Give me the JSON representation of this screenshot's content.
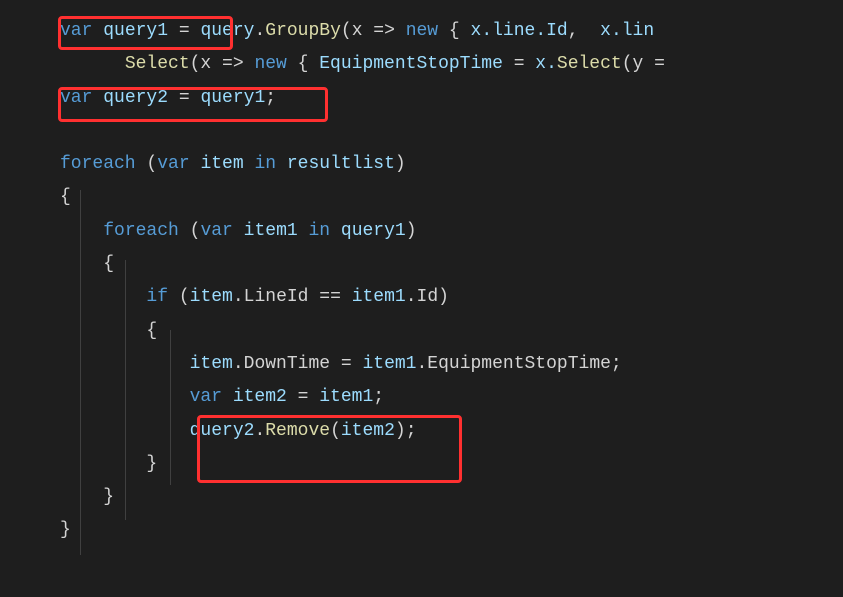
{
  "code": {
    "line1": {
      "var": "var",
      "query1": "query1",
      "eq": " = ",
      "query": "query",
      "dot": ".",
      "groupby": "GroupBy",
      "open": "(x => ",
      "new": "new",
      "brace": " { ",
      "xline": "x.line.Id",
      "comma": ",  ",
      "xlin": "x.lin"
    },
    "line2": {
      "select": "Select",
      "open": "(x => ",
      "new": "new",
      "brace": " { ",
      "estop": "EquipmentStopTime",
      "eq": " = ",
      "xsel": "x.",
      "sel": "Select",
      "y": "(y ="
    },
    "line3": {
      "var": "var",
      "query2": "query2",
      "eq": " = ",
      "query1": "query1",
      "semi": ";"
    },
    "line5": {
      "foreach": "foreach",
      "open": " (",
      "var": "var",
      "item": " item ",
      "in": "in",
      "resultlist": " resultlist",
      "close": ")"
    },
    "line6": {
      "brace": "{"
    },
    "line7": {
      "foreach": "foreach",
      "open": " (",
      "var": "var",
      "item1": " item1 ",
      "in": "in",
      "query1": " query1",
      "close": ")"
    },
    "line8": {
      "brace": "{"
    },
    "line9": {
      "if": "if",
      "open": " (",
      "item": "item",
      "lineid": ".LineId",
      "eqeq": " == ",
      "item1": "item1",
      "id": ".Id",
      "close": ")"
    },
    "line10": {
      "brace": "{"
    },
    "line11": {
      "item": "item",
      "downtime": ".DownTime",
      "eq": " = ",
      "item1": "item1",
      "estop": ".EquipmentStopTime",
      "semi": ";"
    },
    "line12": {
      "var": "var",
      "item2": " item2",
      "eq": " = ",
      "item1": "item1",
      "semi": ";"
    },
    "line13": {
      "query2": "query2",
      "dot": ".",
      "remove": "Remove",
      "open": "(",
      "item2": "item2",
      "close": ")",
      "semi": ";"
    },
    "line14": {
      "brace": "}"
    },
    "line15": {
      "brace": "}"
    },
    "line16": {
      "brace": "}"
    }
  },
  "annotations": {
    "box1": "var query1 =",
    "box2": "var query2 = query1;",
    "box3": "var item2 = item1; query2.Remove(item2);"
  }
}
